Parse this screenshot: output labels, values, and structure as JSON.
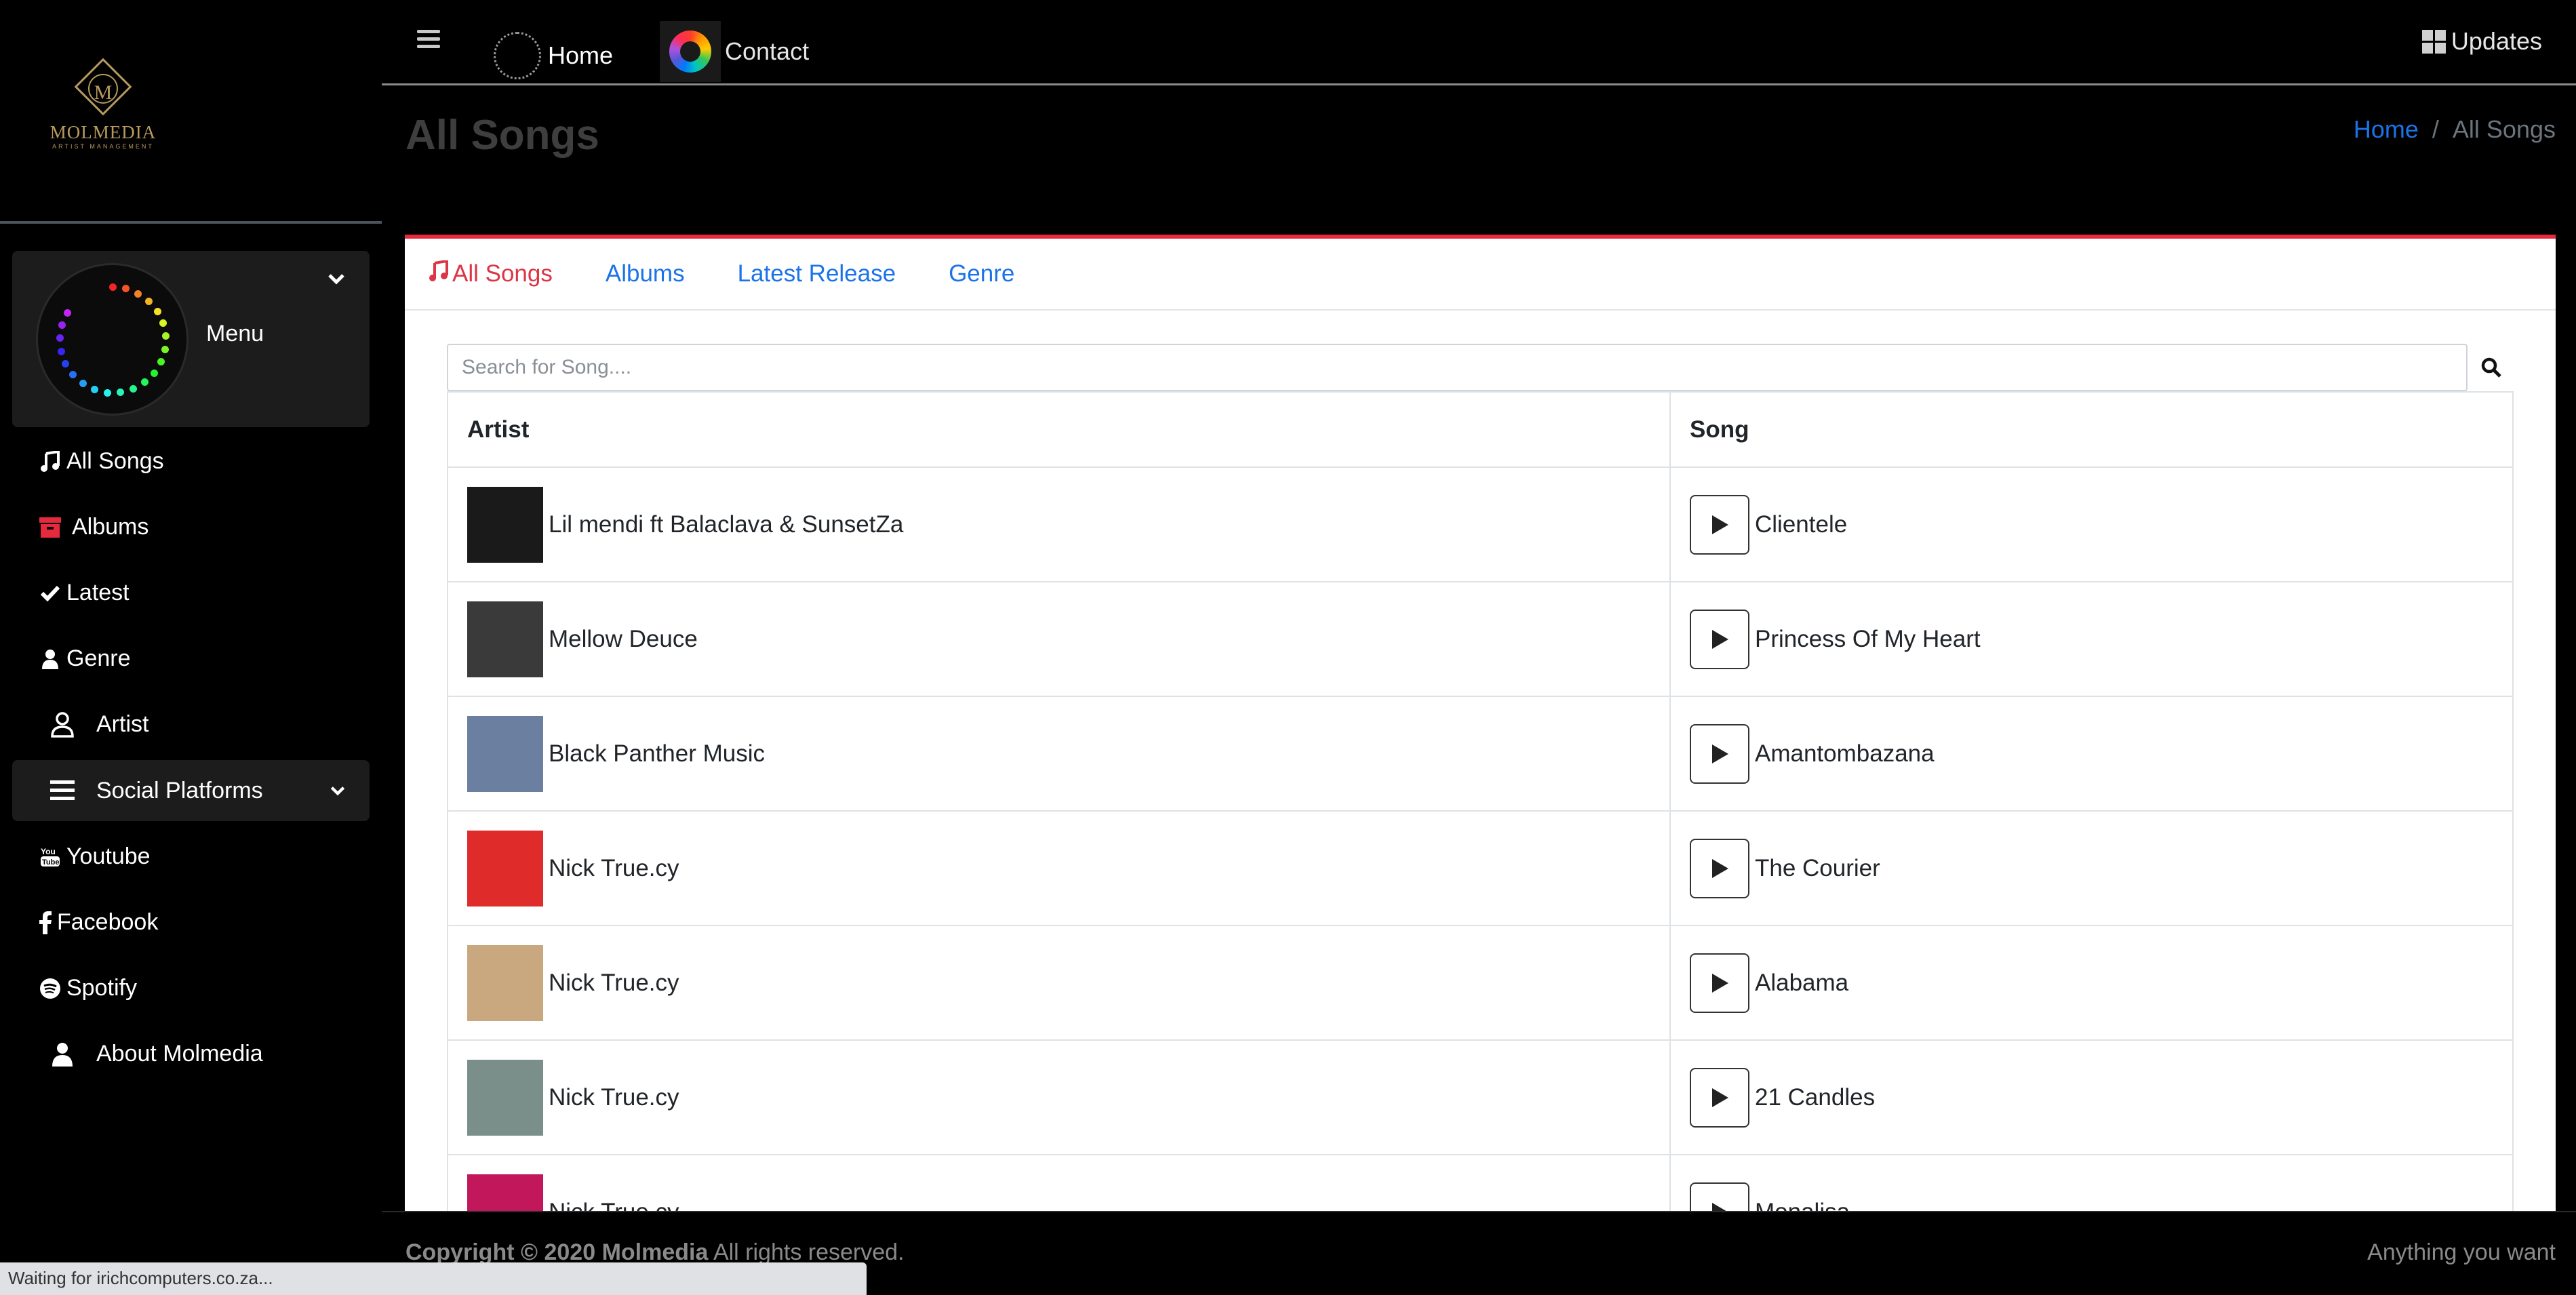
{
  "brand": {
    "name": "MOLMEDIA",
    "subtitle": "ARTIST MANAGEMENT",
    "monogram": "M"
  },
  "sidebar": {
    "menu_label": "Menu",
    "items": [
      {
        "label": "All Songs",
        "icon": "music-note-icon"
      },
      {
        "label": "Albums",
        "icon": "archive-icon"
      },
      {
        "label": "Latest",
        "icon": "check-icon"
      },
      {
        "label": "Genre",
        "icon": "user-icon"
      },
      {
        "label": "Artist",
        "icon": "user-outline-icon"
      },
      {
        "label": "Social Platforms",
        "icon": "list-icon"
      },
      {
        "label": "Youtube",
        "icon": "youtube-icon"
      },
      {
        "label": "Facebook",
        "icon": "facebook-icon"
      },
      {
        "label": "Spotify",
        "icon": "spotify-icon"
      },
      {
        "label": "About Molmedia",
        "icon": "user-icon"
      }
    ]
  },
  "topbar": {
    "home_label": "Home",
    "contact_label": "Contact",
    "updates_label": "Updates"
  },
  "page": {
    "title": "All Songs"
  },
  "breadcrumb": {
    "home": "Home",
    "separator": "/",
    "current": "All Songs"
  },
  "tabs": [
    {
      "label": "All Songs",
      "active": true
    },
    {
      "label": "Albums",
      "active": false
    },
    {
      "label": "Latest Release",
      "active": false
    },
    {
      "label": "Genre",
      "active": false
    }
  ],
  "search": {
    "placeholder": "Search for Song....",
    "value": ""
  },
  "table": {
    "headers": {
      "artist": "Artist",
      "song": "Song"
    },
    "rows": [
      {
        "artist": "Lil mendi ft Balaclava & SunsetZa",
        "song": "Clientele",
        "cover_color": "#1a1a1a"
      },
      {
        "artist": "Mellow Deuce",
        "song": "Princess Of My Heart",
        "cover_color": "#3a3a3a"
      },
      {
        "artist": "Black Panther Music",
        "song": "Amantombazana",
        "cover_color": "#6b7fa0"
      },
      {
        "artist": "Nick True.cy",
        "song": "The Courier",
        "cover_color": "#e02b2b"
      },
      {
        "artist": "Nick True.cy",
        "song": "Alabama",
        "cover_color": "#c9a77f"
      },
      {
        "artist": "Nick True.cy",
        "song": "21 Candles",
        "cover_color": "#7a8f8a"
      },
      {
        "artist": "Nick True.cy",
        "song": "Monalisa",
        "cover_color": "#c2185b"
      }
    ]
  },
  "footer": {
    "copyright_bold": "Copyright © 2020 Molmedia",
    "copyright_rest": " All rights reserved.",
    "right_text": "Anything you want"
  },
  "status": {
    "text": "Waiting for irichcomputers.co.za..."
  },
  "colors": {
    "accent_red": "#dc3545",
    "link_blue": "#1a73e8",
    "card_border": "#e6293d"
  }
}
